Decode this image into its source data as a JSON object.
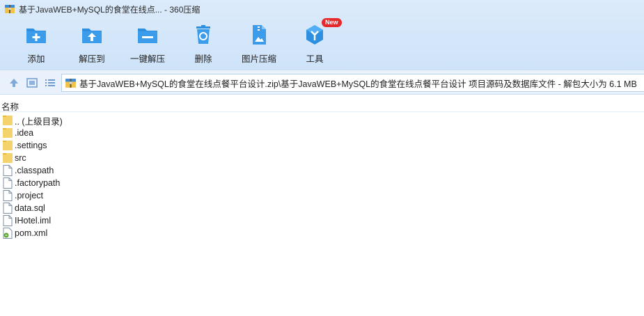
{
  "window": {
    "title": "基于JavaWEB+MySQL的食堂在线点... - 360压缩"
  },
  "toolbar": {
    "items": [
      {
        "label": "添加"
      },
      {
        "label": "解压到"
      },
      {
        "label": "一键解压"
      },
      {
        "label": "删除"
      },
      {
        "label": "图片压缩"
      },
      {
        "label": "工具"
      }
    ],
    "new_badge": "New"
  },
  "address": {
    "path": "基于JavaWEB+MySQL的食堂在线点餐平台设计.zip\\基于JavaWEB+MySQL的食堂在线点餐平台设计 项目源码及数据库文件 - 解包大小为 6.1 MB"
  },
  "list": {
    "column_name": "名称",
    "items": [
      {
        "name": ".. (上级目录)",
        "type": "folder"
      },
      {
        "name": ".idea",
        "type": "folder"
      },
      {
        "name": ".settings",
        "type": "folder"
      },
      {
        "name": "src",
        "type": "folder"
      },
      {
        "name": ".classpath",
        "type": "file"
      },
      {
        "name": ".factorypath",
        "type": "file"
      },
      {
        "name": ".project",
        "type": "file"
      },
      {
        "name": "data.sql",
        "type": "file"
      },
      {
        "name": "IHotel.iml",
        "type": "file"
      },
      {
        "name": "pom.xml",
        "type": "xml-file"
      }
    ]
  },
  "colors": {
    "accent": "#2e8fe0",
    "folder": "#f5d36c",
    "badge": "#e6292b"
  }
}
